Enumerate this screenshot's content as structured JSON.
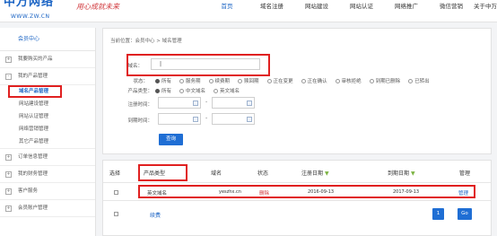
{
  "header": {
    "logo_text": "中万网络",
    "logo_url": "WWW.ZW.CN",
    "slogan": "用心成就未来",
    "nav": [
      "首页",
      "域名注册",
      "网站建设",
      "网站认证",
      "网络推广",
      "微信营销",
      "关于中万"
    ],
    "active_nav": "首页"
  },
  "sidebar": {
    "title": "会员中心",
    "items": [
      {
        "label": "我要购买的产品",
        "expand": "+"
      },
      {
        "label": "我的产品管理",
        "expand": "-"
      },
      {
        "label": "订单信息管理",
        "expand": "+"
      },
      {
        "label": "我的财务管理",
        "expand": "+"
      },
      {
        "label": "客户服务",
        "expand": "+"
      },
      {
        "label": "会员账户管理",
        "expand": "+"
      }
    ],
    "subitems": [
      "域名产品管理",
      "网站建设管理",
      "网站认证管理",
      "网络营销管理",
      "其它产品管理"
    ]
  },
  "search": {
    "breadcrumb": "当前位置：会员中心 > 域名管理",
    "domain_label": "域名：",
    "domain_value": "|",
    "status_label": "状态：",
    "status_options": [
      "所有",
      "服务期",
      "续费期",
      "赎回期",
      "正在变更",
      "正在确认",
      "审核拒绝",
      "到期已删除",
      "已转出"
    ],
    "type_label": "产品类型：",
    "type_options": [
      "所有",
      "中文域名",
      "英文域名"
    ],
    "register_label": "注册时间：",
    "expire_label": "到期时间：",
    "dash": "-",
    "query_button": "查询"
  },
  "table": {
    "headers": [
      "选择",
      "产品类型",
      "域名",
      "状态",
      "注册日期",
      "到期日期",
      "管理"
    ],
    "rows": [
      {
        "type": "英文域名",
        "domain": "yeszhx.cn",
        "status": "删除",
        "reg": "2016-09-13",
        "exp": "2017-09-13",
        "action": "管理"
      }
    ],
    "renew": "续费",
    "page": "1",
    "go": "Go"
  },
  "colors": {
    "accent": "#1f6ed4",
    "highlight": "#e02020",
    "sort_icon": "#7cb342"
  }
}
